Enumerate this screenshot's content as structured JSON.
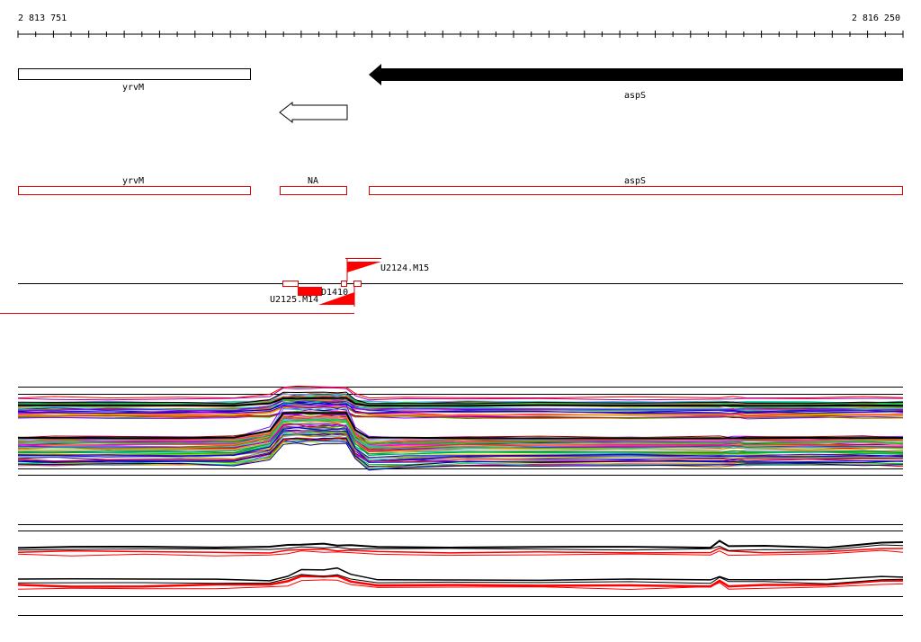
{
  "ruler": {
    "start_label": "2 813 751",
    "end_label": "2 816 250"
  },
  "genes": [
    {
      "name": "yrvM",
      "strand": "+",
      "style": "outline"
    },
    {
      "name": "",
      "strand": "-",
      "style": "outline-arrow"
    },
    {
      "name": "aspS",
      "strand": "-",
      "style": "filled-arrow"
    }
  ],
  "annotation_track": [
    {
      "label": "yrvM"
    },
    {
      "label": "NA"
    },
    {
      "label": "aspS"
    }
  ],
  "features": [
    {
      "label": "U2124.M15",
      "strand": "+"
    },
    {
      "label": "D1410",
      "strand": "+"
    },
    {
      "label": "U2125.M14",
      "strand": "-"
    }
  ],
  "colors": {
    "gene_fill": "#000000",
    "annotation_outline": "#e00000",
    "feature_fill": "#ff0000",
    "axis": "#000000"
  }
}
